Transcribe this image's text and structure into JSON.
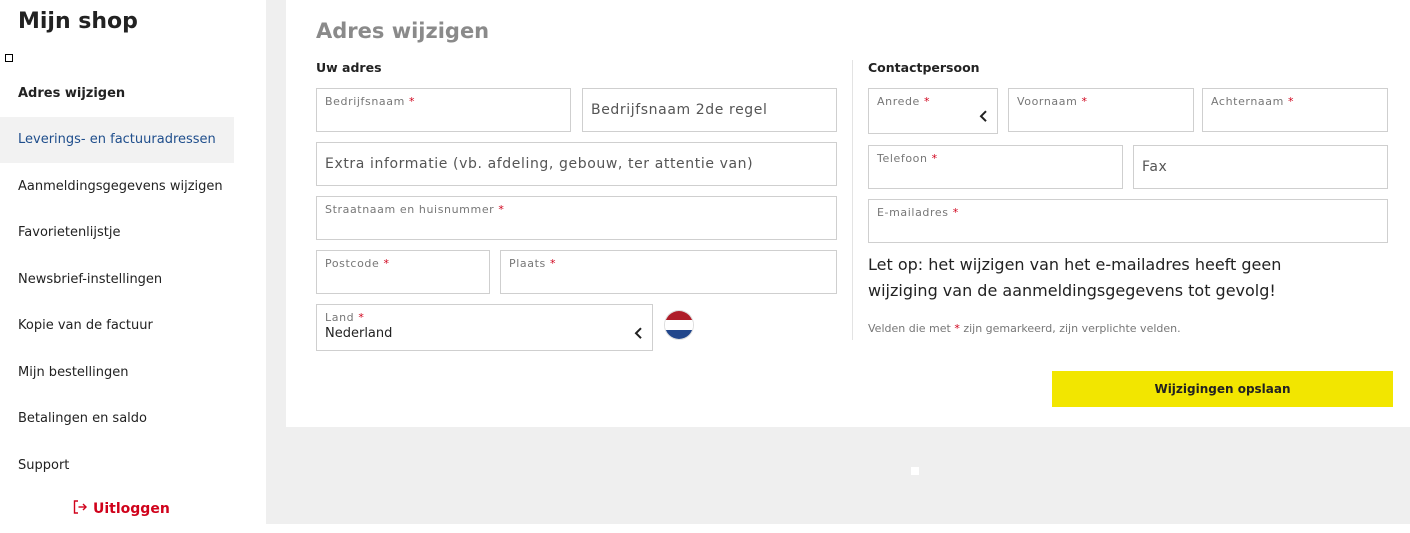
{
  "sidebar": {
    "title": "Mijn shop",
    "items": [
      {
        "label": "Adres wijzigen"
      },
      {
        "label": "Leverings- en factuuradressen"
      },
      {
        "label": "Aanmeldingsgegevens wijzigen"
      },
      {
        "label": "Favorietenlijstje"
      },
      {
        "label": "Newsbrief-instellingen"
      },
      {
        "label": "Kopie van de factuur"
      },
      {
        "label": "Mijn bestellingen"
      },
      {
        "label": "Betalingen en saldo"
      },
      {
        "label": "Support"
      }
    ],
    "logout_label": "Uitloggen",
    "logout_color": "#d0021b"
  },
  "main": {
    "title": "Adres wijzigen",
    "address": {
      "heading": "Uw adres",
      "company_label": "Bedrijfsnaam",
      "company2_placeholder": "Bedrijfsnaam 2de regel",
      "extra_placeholder": "Extra informatie (vb. afdeling, gebouw, ter attentie van)",
      "street_label": "Straatnaam en huisnummer",
      "postcode_label": "Postcode",
      "city_label": "Plaats",
      "country_label": "Land",
      "country_value": "Nederland"
    },
    "contact": {
      "heading": "Contactpersoon",
      "salutation_label": "Anrede",
      "firstname_label": "Voornaam",
      "lastname_label": "Achternaam",
      "phone_label": "Telefoon",
      "fax_placeholder": "Fax",
      "email_label": "E-mailadres"
    },
    "notice": "Let op: het wijzigen van het e-mailadres heeft geen wijziging van de aanmeldingsgegevens tot gevolg!",
    "required_note_before": "Velden die met",
    "required_note_after": "zijn gemarkeerd, zijn verplichte velden.",
    "required_marker": "*",
    "save_label": "Wijzigingen opslaan",
    "save_color": "#f2e600"
  }
}
